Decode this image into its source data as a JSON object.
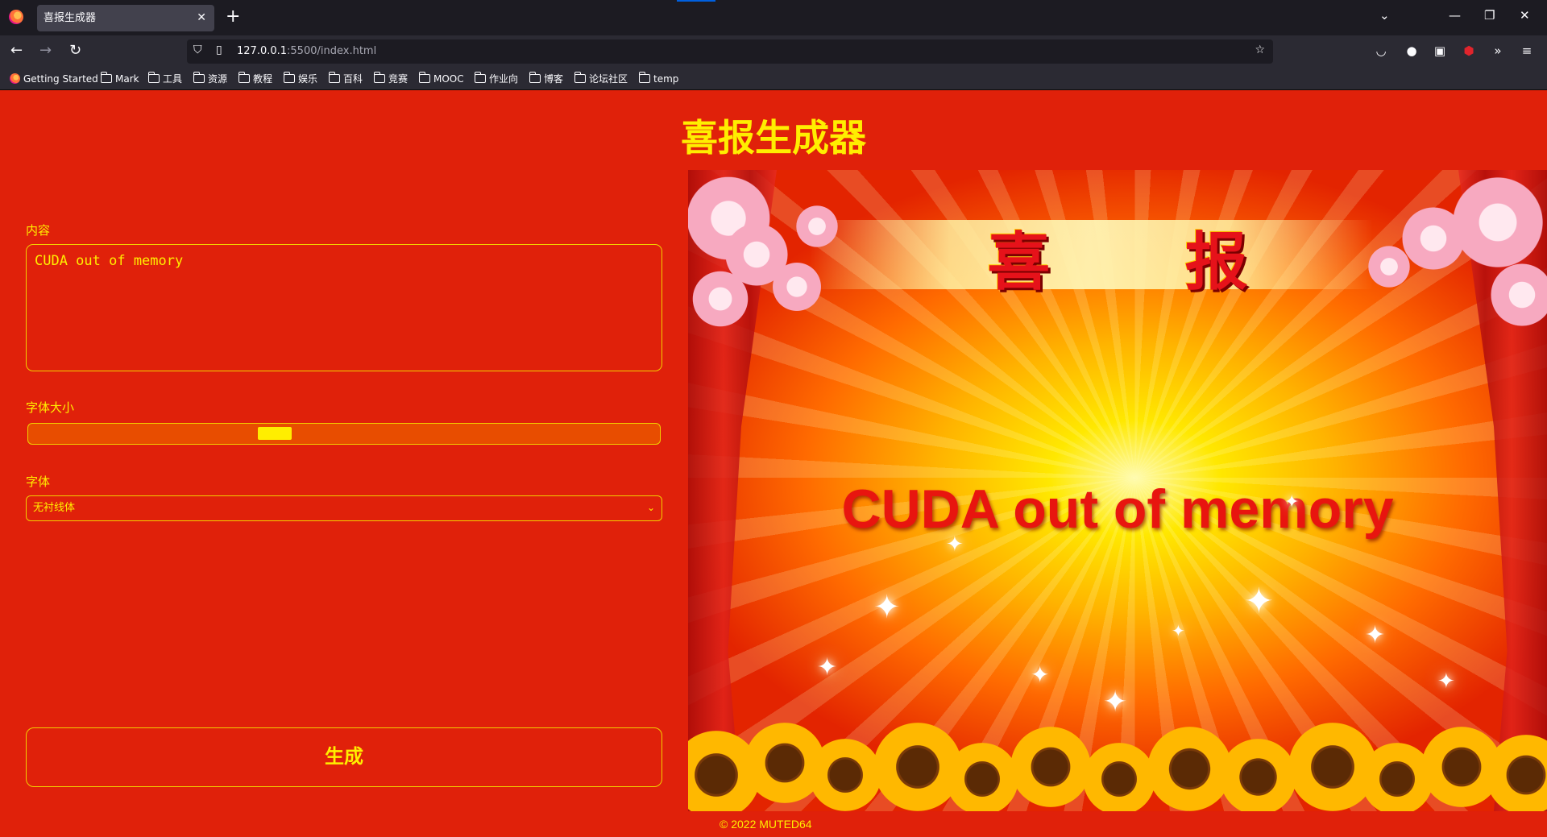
{
  "browser": {
    "tab_title": "喜报生成器",
    "url_host": "127.0.0.1",
    "url_rest": ":5500/index.html",
    "bookmarks": [
      "Getting Started",
      "Mark",
      "工具",
      "资源",
      "教程",
      "娱乐",
      "百科",
      "竞赛",
      "MOOC",
      "作业向",
      "博客",
      "论坛社区",
      "temp"
    ]
  },
  "app": {
    "title": "喜报生成器",
    "content_label": "内容",
    "content_value": "CUDA out of memory",
    "font_size_label": "字体大小",
    "font_size_level": 0.385,
    "font_label": "字体",
    "font_selected": "无衬线体",
    "generate_label": "生成"
  },
  "poster": {
    "heading": "喜 报",
    "text": "CUDA out of memory"
  },
  "footer": {
    "text": "© 2022 MUTED64"
  },
  "colors": {
    "page_bg": "#e0210a",
    "accent": "#ffee00"
  }
}
